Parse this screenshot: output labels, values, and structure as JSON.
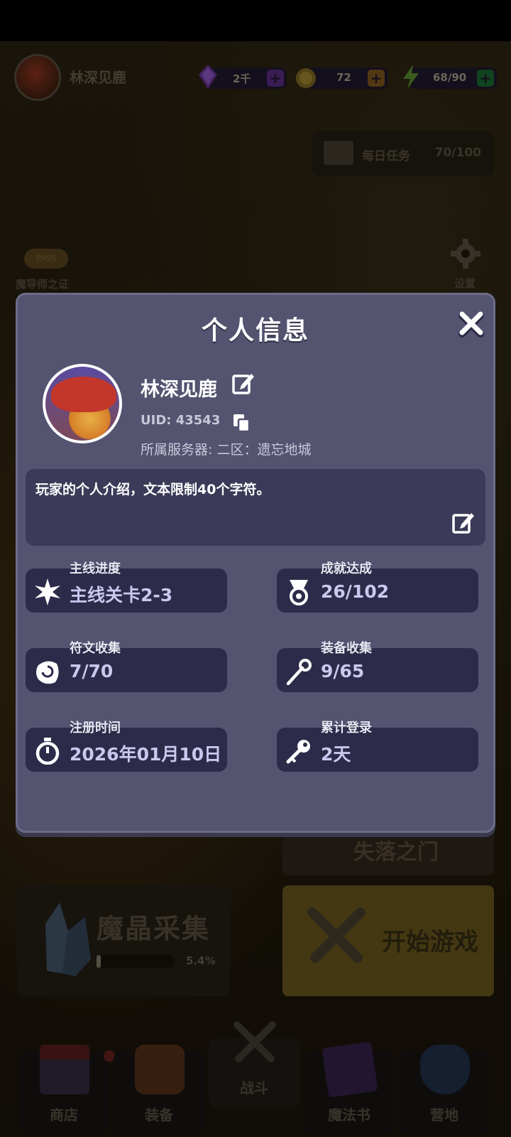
{
  "player": {
    "name": "林深见鹿"
  },
  "resources": {
    "gems": "2千",
    "coins": "72",
    "energy": "68/90"
  },
  "daily_tasks": {
    "label": "每日任务",
    "count": "70/100"
  },
  "side": {
    "pass_badge": "PASS",
    "pass_label": "魔导师之证",
    "settings_label": "设置"
  },
  "lobby": {
    "gate_label": "失落之门",
    "harvest_title": "魔晶采集",
    "harvest_progress_text": "5.4%",
    "harvest_progress": 0.054,
    "start_label": "开始游戏"
  },
  "nav": [
    {
      "label": "商店",
      "icon": "shop-icon"
    },
    {
      "label": "装备",
      "icon": "backpack-icon"
    },
    {
      "label": "战斗",
      "icon": "crossed-swords-icon"
    },
    {
      "label": "魔法书",
      "icon": "spellbook-icon"
    },
    {
      "label": "营地",
      "icon": "shield-crown-icon"
    }
  ],
  "profile": {
    "title": "个人信息",
    "name": "林深见鹿",
    "uid": "UID: 43543",
    "server": "所属服务器: 二区：遗忘地城",
    "bio": "玩家的个人介绍，文本限制40个字符。",
    "stats": [
      {
        "caption": "主线进度",
        "value": "主线关卡2-3",
        "icon": "sparkle-icon"
      },
      {
        "caption": "成就达成",
        "value": "26/102",
        "icon": "medal-icon"
      },
      {
        "caption": "符文收集",
        "value": "7/70",
        "icon": "rune-stone-icon"
      },
      {
        "caption": "装备收集",
        "value": "9/65",
        "icon": "staff-icon"
      },
      {
        "caption": "注册时间",
        "value": "2026年01月10日",
        "icon": "stopwatch-icon"
      },
      {
        "caption": "累计登录",
        "value": "2天",
        "icon": "key-icon"
      }
    ]
  },
  "colors": {
    "modal_bg": "#545370",
    "stat_bg": "#2c2b49",
    "gem_plus": "#9b3ad8",
    "coin_plus": "#e08a2a",
    "energy_plus": "#1fb34a"
  }
}
